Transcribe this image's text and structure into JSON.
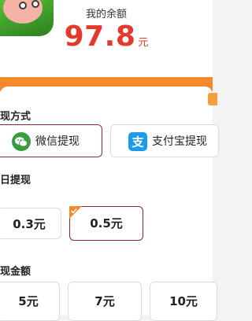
{
  "balance": {
    "label": "我的余额",
    "amount": "97.8",
    "unit": "元",
    "color": "#e4392b"
  },
  "accent_color": "#f08a2c",
  "withdraw_method": {
    "title": "现方式",
    "options": [
      {
        "label": "微信提现",
        "icon": "wechat-icon",
        "selected": true
      },
      {
        "label": "支付宝提现",
        "icon": "alipay-icon",
        "selected": false
      }
    ]
  },
  "daily_withdraw": {
    "title": "日提现",
    "options": [
      {
        "label": "0.3元",
        "selected": false
      },
      {
        "label": "0.5元",
        "selected": true
      }
    ]
  },
  "cash_amount": {
    "title": "现金额",
    "options": [
      {
        "label": "5元"
      },
      {
        "label": "7元"
      },
      {
        "label": "10元"
      }
    ]
  }
}
